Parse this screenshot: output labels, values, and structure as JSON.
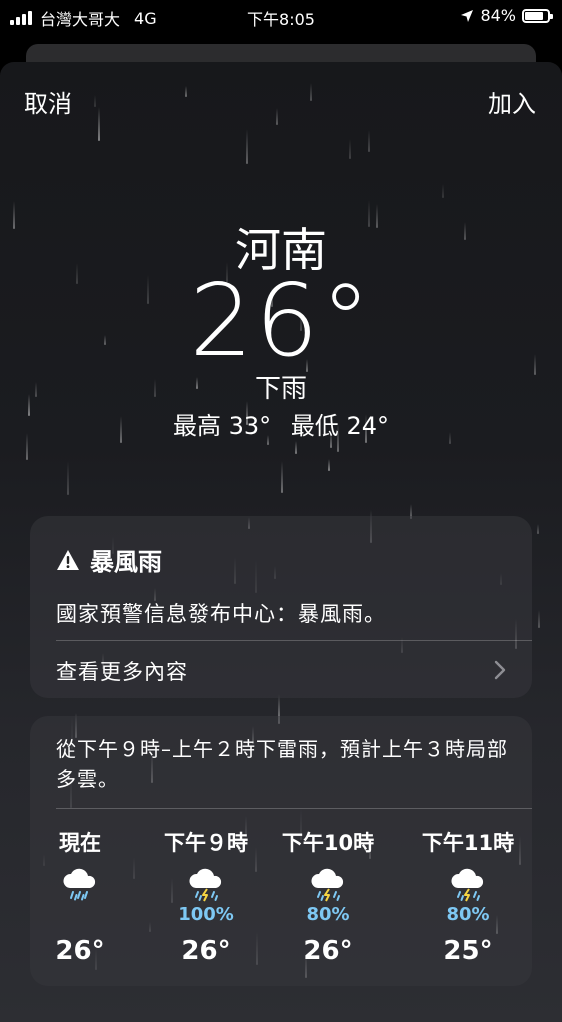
{
  "status_bar": {
    "carrier": "台灣大哥大",
    "network": "4G",
    "time": "下午8:05",
    "battery_text": "84%",
    "battery_level": 0.84,
    "signal_bars": 4
  },
  "nav": {
    "cancel_label": "取消",
    "add_label": "加入"
  },
  "weather": {
    "city": "河南",
    "temperature": "26°",
    "condition": "下雨",
    "high": "最高 33°",
    "low": "最低 24°"
  },
  "alert": {
    "icon": "warning-triangle-icon",
    "title": "暴風雨",
    "body": "國家預警信息發布中心：暴風雨。",
    "more_label": "查看更多內容"
  },
  "hourly": {
    "summary": "從下午９時–上午２時下雷雨，預計上午３時局部多雲。",
    "accent_color": "#7ec8f3",
    "items": [
      {
        "label": "現在",
        "icon": "cloud-rain-icon",
        "precip": "",
        "temp": "26°"
      },
      {
        "label": "下午９時",
        "icon": "cloud-bolt-rain-icon",
        "precip": "100%",
        "temp": "26°"
      },
      {
        "label": "下午10時",
        "icon": "cloud-bolt-rain-icon",
        "precip": "80%",
        "temp": "26°"
      },
      {
        "label": "下午11時",
        "icon": "cloud-bolt-rain-icon",
        "precip": "80%",
        "temp": "25°"
      }
    ]
  }
}
